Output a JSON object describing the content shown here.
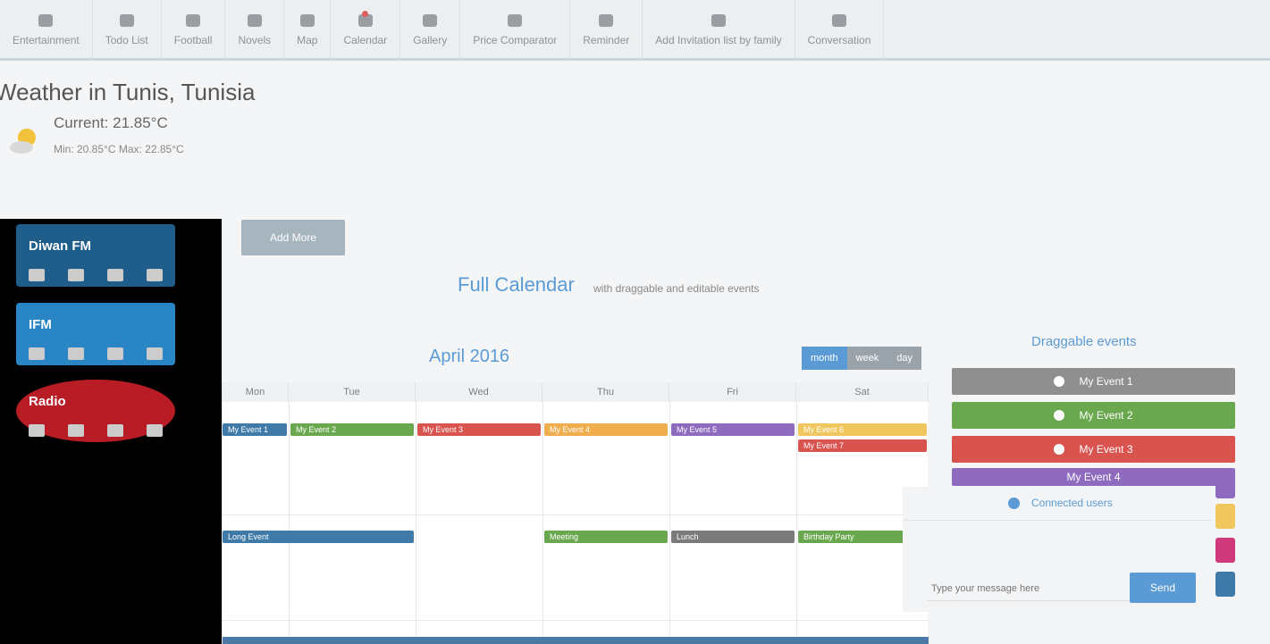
{
  "toolbar": {
    "items": [
      {
        "label": "Entertainment"
      },
      {
        "label": "Todo List"
      },
      {
        "label": "Football"
      },
      {
        "label": "Novels"
      },
      {
        "label": "Map"
      },
      {
        "label": "Calendar"
      },
      {
        "label": "Gallery"
      },
      {
        "label": "Price Comparator"
      },
      {
        "label": "Reminder"
      },
      {
        "label": "Add Invitation list by family"
      },
      {
        "label": "Conversation"
      }
    ]
  },
  "weather": {
    "title": "Weather in Tunis, Tunisia",
    "current": "Current: 21.85°C",
    "range": "Min: 20.85°C  Max: 22.85°C",
    "icon": "sun-cloud-icon"
  },
  "ads": [
    {
      "name": "Diwan FM",
      "color": "#1f5d8a"
    },
    {
      "name": "IFM",
      "color": "#2a85c4"
    },
    {
      "name": "Radio",
      "color": "#b81c24"
    }
  ],
  "add_more_label": "Add More",
  "calendar": {
    "heading": "Full Calendar",
    "subheading": "with draggable and editable events",
    "month_title": "April 2016",
    "view_buttons": [
      {
        "label": "month",
        "color": "#5b9bd5"
      },
      {
        "label": "week",
        "color": "#9aa3aa"
      },
      {
        "label": "day",
        "color": "#9aa3aa"
      }
    ],
    "day_headers": [
      "Mon",
      "Tue",
      "Wed",
      "Thu",
      "Fri",
      "Sat"
    ],
    "events": [
      {
        "title": "My Event 1",
        "color": "#3f7aa8"
      },
      {
        "title": "My Event 2",
        "color": "#6aa84f"
      },
      {
        "title": "My Event 3",
        "color": "#d9534f"
      },
      {
        "title": "My Event 4",
        "color": "#f0ad4e"
      },
      {
        "title": "My Event 5",
        "color": "#8e6bbf"
      },
      {
        "title": "My Event 6",
        "color": "#f0c75e"
      },
      {
        "title": "My Event 7",
        "color": "#d9534f"
      },
      {
        "title": "Long Event",
        "color": "#3f7aa8"
      },
      {
        "title": "Meeting",
        "color": "#6aa84f"
      },
      {
        "title": "Lunch",
        "color": "#7b7b7b"
      },
      {
        "title": "Birthday Party",
        "color": "#6aa84f"
      }
    ]
  },
  "draggable": {
    "heading": "Draggable events",
    "items": [
      {
        "label": "My Event 1",
        "color": "#8f8f8f"
      },
      {
        "label": "My Event 2",
        "color": "#6aa84f"
      },
      {
        "label": "My Event 3",
        "color": "#d9534f"
      },
      {
        "label": "My Event 4",
        "color": "#8e6bbf"
      }
    ]
  },
  "chat": {
    "status": "Connected users",
    "input_placeholder": "Type your message here",
    "send_label": "Send",
    "swatches": [
      "#8e6bbf",
      "#f0c75e",
      "#d13a7a",
      "#3f7aa8"
    ]
  }
}
